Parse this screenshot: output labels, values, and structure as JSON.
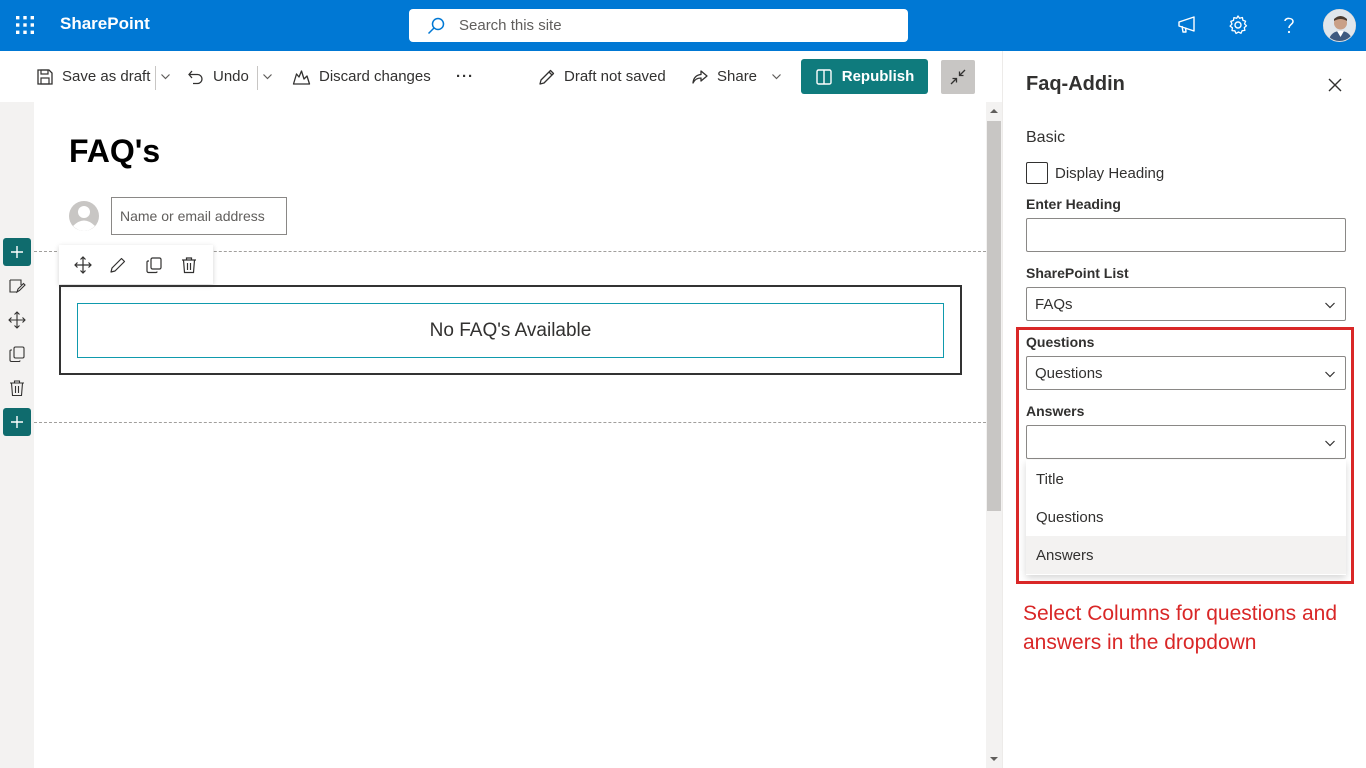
{
  "suite": {
    "brand": "SharePoint",
    "search_placeholder": "Search this site",
    "icons": [
      "app-launcher-icon",
      "megaphone-icon",
      "gear-icon",
      "help-icon"
    ]
  },
  "command_bar": {
    "save_label": "Save as draft",
    "undo_label": "Undo",
    "discard_label": "Discard changes",
    "more_label": "···",
    "status_label": "Draft not saved",
    "share_label": "Share",
    "republish_label": "Republish"
  },
  "page": {
    "title": "FAQ's",
    "author_placeholder": "Name or email address",
    "empty_message": "No FAQ's Available"
  },
  "pane": {
    "title": "Faq-Addin",
    "group_title": "Basic",
    "display_heading_label": "Display Heading",
    "display_heading_checked": false,
    "enter_heading_label": "Enter Heading",
    "enter_heading_value": "",
    "list_label": "SharePoint List",
    "list_value": "FAQs",
    "questions_label": "Questions",
    "questions_value": "Questions",
    "answers_label": "Answers",
    "answers_value": "",
    "answers_options": [
      "Title",
      "Questions",
      "Answers"
    ],
    "answers_hovered_option": "Answers"
  },
  "annotation": {
    "text": "Select Columns for questions and answers in the dropdown",
    "color": "#d92727"
  },
  "colors": {
    "suite_bar": "#0078d4",
    "republish": "#0f7b7d",
    "accent_teal": "#0f6b6d"
  }
}
